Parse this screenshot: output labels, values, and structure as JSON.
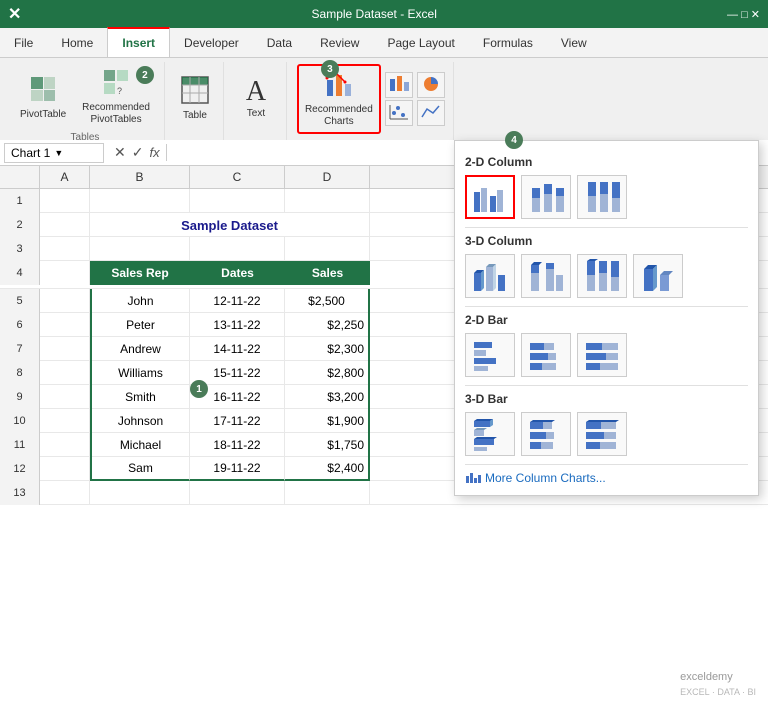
{
  "titlebar": {
    "filename": "Sample Dataset - Excel",
    "brand": "X"
  },
  "ribbon": {
    "tabs": [
      "File",
      "Home",
      "Insert",
      "Developer",
      "Data",
      "Review",
      "Page Layout",
      "Formulas",
      "View"
    ],
    "active_tab": "Insert",
    "groups": {
      "tables": {
        "label": "Tables",
        "buttons": [
          "PivotTable",
          "Recommended PivotTables",
          "Table"
        ]
      },
      "illustrations": {
        "label": "",
        "buttons": [
          "Text"
        ]
      },
      "charts": {
        "label": "",
        "buttons": [
          "Recommended Charts"
        ]
      }
    }
  },
  "formula_bar": {
    "name_box": "Chart 1",
    "fx": "fx"
  },
  "sheet": {
    "columns": [
      "A",
      "B",
      "C",
      "D"
    ],
    "rows": [
      {
        "num": 1,
        "cells": [
          "",
          "",
          "",
          ""
        ]
      },
      {
        "num": 2,
        "cells": [
          "",
          "Sample Dataset",
          "",
          ""
        ]
      },
      {
        "num": 3,
        "cells": [
          "",
          "",
          "",
          ""
        ]
      },
      {
        "num": 4,
        "cells": [
          "",
          "Sales Rep",
          "Dates",
          "Sales"
        ]
      },
      {
        "num": 5,
        "cells": [
          "",
          "John",
          "12-11-22",
          "$2,500"
        ]
      },
      {
        "num": 6,
        "cells": [
          "",
          "Peter",
          "13-11-22",
          "$2,250"
        ]
      },
      {
        "num": 7,
        "cells": [
          "",
          "Andrew",
          "14-11-22",
          "$2,300"
        ]
      },
      {
        "num": 8,
        "cells": [
          "",
          "Williams",
          "15-11-22",
          "$2,800"
        ]
      },
      {
        "num": 9,
        "cells": [
          "",
          "Smith",
          "16-11-22",
          "$3,200"
        ]
      },
      {
        "num": 10,
        "cells": [
          "",
          "Johnson",
          "17-11-22",
          "$1,900"
        ]
      },
      {
        "num": 11,
        "cells": [
          "",
          "Michael",
          "18-11-22",
          "$1,750"
        ]
      },
      {
        "num": 12,
        "cells": [
          "",
          "Sam",
          "19-11-22",
          "$2,400"
        ]
      },
      {
        "num": 13,
        "cells": [
          "",
          "",
          "",
          ""
        ]
      }
    ]
  },
  "chart_dropdown": {
    "sections": [
      {
        "label": "2-D Column",
        "icons": [
          "2d-col-clustered",
          "2d-col-stacked",
          "2d-col-100"
        ]
      },
      {
        "label": "3-D Column",
        "icons": [
          "3d-col-clustered",
          "3d-col-stacked",
          "3d-col-100",
          "3d-col-single"
        ]
      },
      {
        "label": "2-D Bar",
        "icons": [
          "2d-bar-clustered",
          "2d-bar-stacked",
          "2d-bar-100"
        ]
      },
      {
        "label": "3-D Bar",
        "icons": [
          "3d-bar-clustered",
          "3d-bar-stacked",
          "3d-bar-100"
        ]
      }
    ],
    "more_link": "More Column Charts..."
  },
  "badges": {
    "b1": "1",
    "b2": "2",
    "b3": "3",
    "b4": "4"
  }
}
